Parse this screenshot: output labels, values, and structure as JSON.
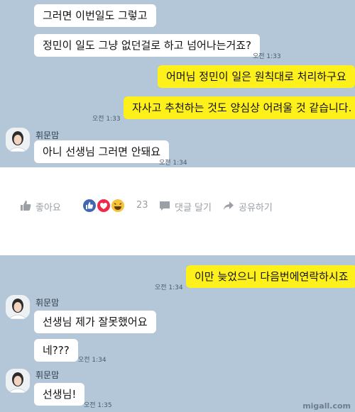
{
  "chat_top": {
    "messages": [
      {
        "text": "그러면 이번일도 그렇고",
        "side": "received"
      },
      {
        "text": "정민이 일도 그냥 없던걸로 하고 넘어나는거죠?",
        "side": "received",
        "time": "오전 1:33"
      },
      {
        "text": "어머님 정민이 일은 원칙대로 처리하구요",
        "side": "sent"
      },
      {
        "text": "자사고 추천하는 것도 양심상 어려울 것 같습니다.",
        "side": "sent",
        "time": "오전 1:33"
      }
    ],
    "sender_name": "휘문맘",
    "reply": {
      "text": "아니 선생님 그러면 안돼요",
      "time": "오전 1:34"
    }
  },
  "social_bar": {
    "like_label": "좋아요",
    "reaction_count": "23",
    "comment_label": "댓글 달기",
    "share_label": "공유하기"
  },
  "chat_bottom": {
    "sent": {
      "text": "이만 늦었으니 다음번에연락하시죠",
      "time": "오전 1:34"
    },
    "sender_name": "휘문맘",
    "messages": [
      {
        "text": "선생님 제가 잘못했어요"
      },
      {
        "text": "네???",
        "time": "오전 1:34"
      }
    ],
    "sender_name2": "휘문맘",
    "last": {
      "text": "선생님!",
      "time": "오전 1:35"
    }
  },
  "watermark": "migall.com",
  "colors": {
    "chat_bg": "#b3c7d9",
    "sent_bubble": "#fef01b",
    "received_bubble": "#ffffff",
    "like_blue": "#4267b2",
    "love_red": "#f0284a",
    "haha_yellow": "#f7c23a"
  }
}
